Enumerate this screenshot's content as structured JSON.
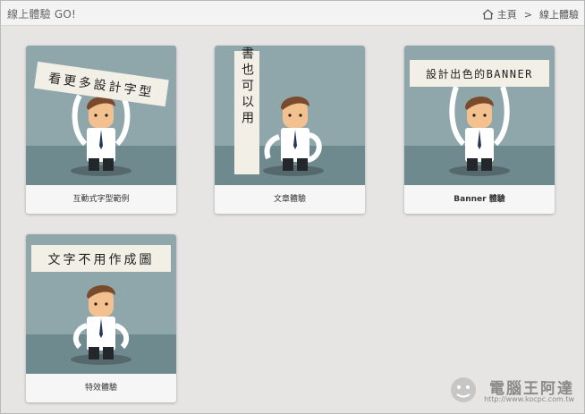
{
  "header": {
    "app_title": "線上體驗 GO!",
    "breadcrumb": {
      "home_label": "主頁",
      "separator": ">",
      "current": "線上體驗"
    }
  },
  "cards": [
    {
      "sign_text": "看更多設計字型",
      "caption": "互動式字型範例"
    },
    {
      "sign_text": "電子書也可以用",
      "caption": "文章體驗"
    },
    {
      "sign_text": "設計出色的BANNER",
      "caption": "Banner 體驗"
    },
    {
      "sign_text": "文字不用作成圖",
      "caption": "特效體驗"
    }
  ],
  "watermark": {
    "name": "電腦王阿達",
    "url": "http://www.kocpc.com.tw"
  },
  "colors": {
    "scene_sky": "#8fa7ab",
    "scene_floor": "#6f8a8f",
    "sign_paper": "#f2efe6",
    "shirt": "#ffffff",
    "tie": "#25375a",
    "hair": "#7a4a2c",
    "skin": "#f3c08f"
  }
}
